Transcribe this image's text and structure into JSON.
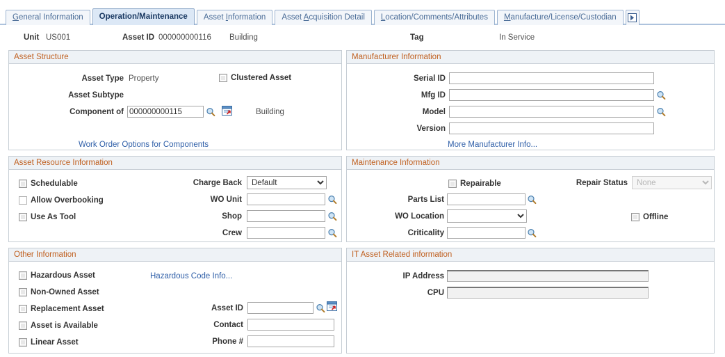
{
  "tabs": [
    {
      "label": "General Information",
      "accel": "G",
      "active": false
    },
    {
      "label": "Operation/Maintenance",
      "accel": "",
      "active": true
    },
    {
      "label": "Asset Information",
      "accel": "A",
      "active": false
    },
    {
      "label": "Asset Acquisition Detail",
      "accel": "A",
      "active": false
    },
    {
      "label": "Location/Comments/Attributes",
      "accel": "L",
      "active": false
    },
    {
      "label": "Manufacture/License/Custodian",
      "accel": "M",
      "active": false
    }
  ],
  "tab_next_icon": "next-arrow-icon",
  "header": {
    "unit_label": "Unit",
    "unit_value": "US001",
    "asset_id_label": "Asset ID",
    "asset_id_value": "000000000116",
    "asset_desc": "Building",
    "tag_label": "Tag",
    "tag_value": "",
    "status_value": "In Service"
  },
  "asset_structure": {
    "title": "Asset Structure",
    "asset_type_label": "Asset Type",
    "asset_type_value": "Property",
    "clustered_asset_label": "Clustered Asset",
    "clustered_asset_checked": false,
    "asset_subtype_label": "Asset Subtype",
    "asset_subtype_value": "",
    "component_of_label": "Component of",
    "component_of_value": "000000000115",
    "component_of_desc": "Building",
    "lookup_icon": "search-lookup-icon",
    "new_window_icon": "open-new-window-icon",
    "work_order_link": "Work Order Options for Components"
  },
  "manufacturer": {
    "title": "Manufacturer Information",
    "fields": [
      {
        "label": "Serial ID",
        "value": "",
        "lookup": false
      },
      {
        "label": "Mfg ID",
        "value": "",
        "lookup": true
      },
      {
        "label": "Model",
        "value": "",
        "lookup": true
      },
      {
        "label": "Version",
        "value": "",
        "lookup": false
      }
    ],
    "more_link": "More Manufacturer Info...",
    "lookup_icon": "search-lookup-icon"
  },
  "asset_resource": {
    "title": "Asset Resource Information",
    "checkboxes": [
      {
        "label": "Schedulable",
        "checked": false,
        "style": "shaded"
      },
      {
        "label": "Allow Overbooking",
        "checked": false,
        "style": "plain"
      },
      {
        "label": "Use As Tool",
        "checked": false,
        "style": "shaded"
      }
    ],
    "charge_back_label": "Charge Back",
    "charge_back_value": "Default",
    "charge_back_options": [
      "Default"
    ],
    "wo_unit_label": "WO Unit",
    "wo_unit_value": "",
    "shop_label": "Shop",
    "shop_value": "",
    "crew_label": "Crew",
    "crew_value": "",
    "lookup_icon": "search-lookup-icon"
  },
  "maintenance": {
    "title": "Maintenance Information",
    "repairable_label": "Repairable",
    "repairable_checked": false,
    "repair_status_label": "Repair Status",
    "repair_status_value": "None",
    "repair_status_options": [
      "None"
    ],
    "repair_status_disabled": true,
    "parts_list_label": "Parts List",
    "parts_list_value": "",
    "wo_location_label": "WO Location",
    "wo_location_value": "",
    "wo_location_options": [
      ""
    ],
    "criticality_label": "Criticality",
    "criticality_value": "",
    "offline_label": "Offline",
    "offline_checked": false,
    "lookup_icon": "search-lookup-icon"
  },
  "other_information": {
    "title": "Other Information",
    "checkboxes": [
      {
        "label": "Hazardous Asset",
        "checked": false
      },
      {
        "label": "Non-Owned Asset",
        "checked": false
      },
      {
        "label": "Replacement Asset",
        "checked": false
      },
      {
        "label": "Asset is Available",
        "checked": false
      },
      {
        "label": "Linear Asset",
        "checked": false
      }
    ],
    "hazardous_link": "Hazardous Code Info...",
    "asset_id_label": "Asset ID",
    "asset_id_value": "",
    "contact_label": "Contact",
    "contact_value": "",
    "phone_label": "Phone #",
    "phone_value": "",
    "lookup_icon": "search-lookup-icon",
    "new_window_icon": "open-new-window-icon"
  },
  "it_asset": {
    "title": "IT Asset Related information",
    "ip_address_label": "IP Address",
    "ip_address_value": "",
    "cpu_label": "CPU",
    "cpu_value": ""
  },
  "colors": {
    "section_header_text": "#c06020",
    "section_header_bg": "#eef2f6",
    "link": "#2f5fa8",
    "tab_active_bg": "#dce8f6",
    "panel_border": "#c6cdd4"
  }
}
